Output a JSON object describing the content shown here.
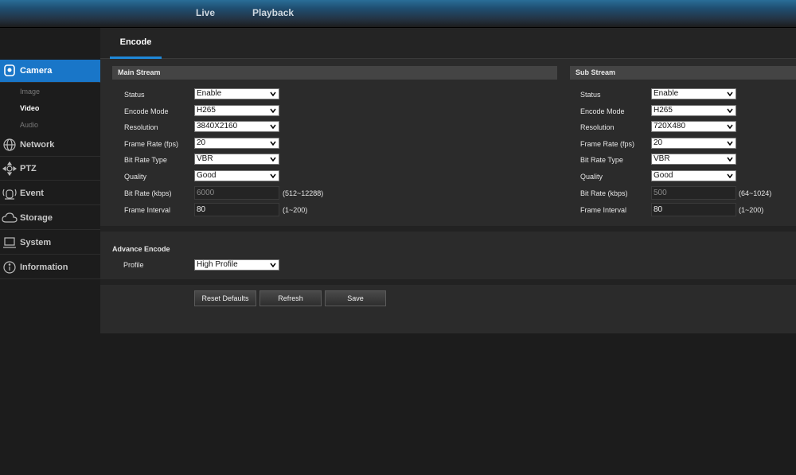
{
  "topnav": {
    "live": "Live",
    "playback": "Playback"
  },
  "sidebar": {
    "camera": "Camera",
    "camera_sub": [
      "Image",
      "Video",
      "Audio"
    ],
    "network": "Network",
    "ptz": "PTZ",
    "event": "Event",
    "storage": "Storage",
    "system": "System",
    "information": "Information"
  },
  "tabs": {
    "encode": "Encode"
  },
  "main_stream": {
    "title": "Main Stream",
    "status_label": "Status",
    "status": "Enable",
    "encode_mode_label": "Encode Mode",
    "encode_mode": "H265",
    "resolution_label": "Resolution",
    "resolution": "3840X2160",
    "frame_rate_label": "Frame Rate (fps)",
    "frame_rate": "20",
    "bitrate_type_label": "Bit Rate Type",
    "bitrate_type": "VBR",
    "quality_label": "Quality",
    "quality": "Good",
    "bitrate_label": "Bit Rate (kbps)",
    "bitrate": "6000",
    "bitrate_range": "(512~12288)",
    "frame_interval_label": "Frame Interval",
    "frame_interval": "80",
    "frame_interval_range": "(1~200)"
  },
  "sub_stream": {
    "title": "Sub Stream",
    "status_label": "Status",
    "status": "Enable",
    "encode_mode_label": "Encode Mode",
    "encode_mode": "H265",
    "resolution_label": "Resolution",
    "resolution": "720X480",
    "frame_rate_label": "Frame Rate (fps)",
    "frame_rate": "20",
    "bitrate_type_label": "Bit Rate Type",
    "bitrate_type": "VBR",
    "quality_label": "Quality",
    "quality": "Good",
    "bitrate_label": "Bit Rate (kbps)",
    "bitrate": "500",
    "bitrate_range": "(64~1024)",
    "frame_interval_label": "Frame Interval",
    "frame_interval": "80",
    "frame_interval_range": "(1~200)"
  },
  "advance": {
    "title": "Advance Encode",
    "profile_label": "Profile",
    "profile": "High Profile"
  },
  "buttons": {
    "reset": "Reset Defaults",
    "refresh": "Refresh",
    "save": "Save"
  },
  "colors": {
    "accent": "#1976c8",
    "tab_underline": "#1f88d8",
    "panel": "#2b2b2b"
  }
}
